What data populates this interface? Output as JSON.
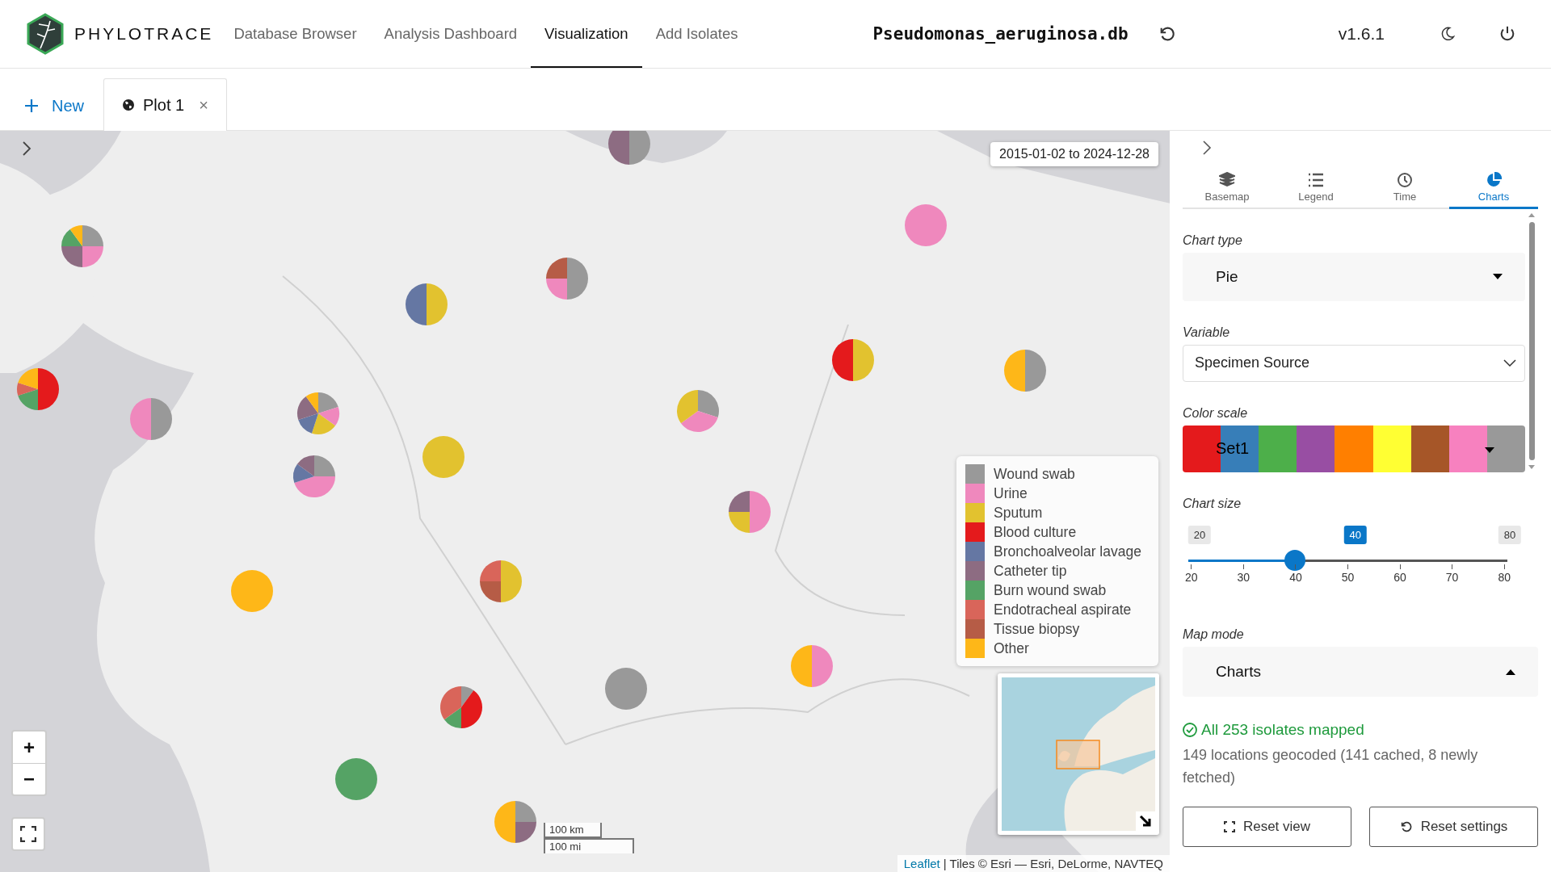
{
  "header": {
    "brand": "PHYLOTRACE",
    "nav": [
      {
        "label": "Database Browser",
        "selected": false
      },
      {
        "label": "Analysis Dashboard",
        "selected": false
      },
      {
        "label": "Visualization",
        "selected": true
      },
      {
        "label": "Add Isolates",
        "selected": false
      }
    ],
    "database": "Pseudomonas_aeruginosa.db",
    "version": "v1.6.1"
  },
  "plot_tabs": {
    "new_label": "New",
    "tabs": [
      {
        "label": "Plot 1",
        "close": "×",
        "selected": true
      }
    ]
  },
  "map": {
    "date_range": "2015-01-02 to 2024-12-28",
    "legend": [
      {
        "label": "Wound swab",
        "color": "#999999"
      },
      {
        "label": "Urine",
        "color": "#ef88bd"
      },
      {
        "label": "Sputum",
        "color": "#e2c22f"
      },
      {
        "label": "Blood culture",
        "color": "#e41a1c"
      },
      {
        "label": "Bronchoalveolar lavage",
        "color": "#6577a3"
      },
      {
        "label": "Catheter tip",
        "color": "#8d6c82"
      },
      {
        "label": "Burn wound swab",
        "color": "#55a365"
      },
      {
        "label": "Endotracheal aspirate",
        "color": "#d9655a"
      },
      {
        "label": "Tissue biopsy",
        "color": "#b65c46"
      },
      {
        "label": "Other",
        "color": "#feb718"
      }
    ],
    "zoom_in": "+",
    "zoom_out": "−",
    "scale": [
      "100 km",
      "100 mi"
    ],
    "attribution_link": "Leaflet",
    "attribution": "| Tiles © Esri — Esri, DeLorme, NAVTEQ"
  },
  "panel": {
    "tabs": [
      {
        "label": "Basemap",
        "selected": false
      },
      {
        "label": "Legend",
        "selected": false
      },
      {
        "label": "Time",
        "selected": false
      },
      {
        "label": "Charts",
        "selected": true
      }
    ],
    "chart_type": {
      "label": "Chart type",
      "value": "Pie"
    },
    "variable": {
      "label": "Variable",
      "value": "Specimen Source"
    },
    "color_scale": {
      "label": "Color scale",
      "value": "Set1"
    },
    "chart_size": {
      "label": "Chart size",
      "min": "20",
      "value": "40",
      "max": "80",
      "level": 0.333,
      "ticks": [
        "20",
        "30",
        "40",
        "50",
        "60",
        "70",
        "80"
      ]
    },
    "map_mode": {
      "label": "Map mode",
      "value": "Charts",
      "expanded": true
    },
    "status": "All 253 isolates mapped",
    "detail": "149 locations geocoded (141 cached, 8 newly fetched)",
    "buttons": [
      "Reset view",
      "Reset settings"
    ]
  }
}
